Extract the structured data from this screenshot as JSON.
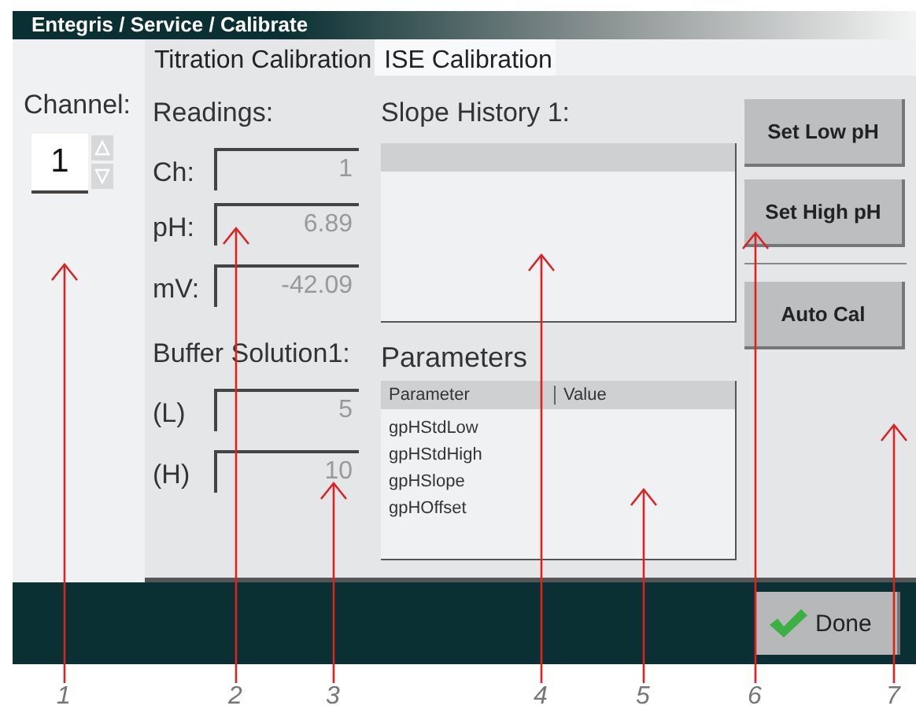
{
  "window": {
    "title": "Entegris / Service / Calibrate"
  },
  "channel": {
    "label": "Channel:",
    "value": "1"
  },
  "tabs": [
    {
      "label": "Titration Calibration",
      "selected": true
    },
    {
      "label": "ISE Calibration",
      "selected": false
    }
  ],
  "readings": {
    "title": "Readings:",
    "rows": [
      {
        "label": "Ch:",
        "value": "1"
      },
      {
        "label": "pH:",
        "value": "6.89"
      },
      {
        "label": "mV:",
        "value": "-42.09"
      }
    ]
  },
  "buffer": {
    "title": "Buffer Solution1:",
    "rows": [
      {
        "label": "(L)",
        "value": "5"
      },
      {
        "label": "(H)",
        "value": "10"
      }
    ]
  },
  "slope_history": {
    "title": "Slope History 1:"
  },
  "parameters": {
    "title": "Parameters",
    "columns": [
      "Parameter",
      "Value"
    ],
    "rows": [
      "gpHStdLow",
      "gpHStdHigh",
      "gpHSlope",
      "gpHOffset"
    ]
  },
  "set_buttons": [
    "Set Low pH",
    "Set High pH"
  ],
  "auto_button": "Auto Cal",
  "done_button": "Done",
  "callouts": [
    "1",
    "2",
    "3",
    "4",
    "5",
    "6",
    "7"
  ]
}
